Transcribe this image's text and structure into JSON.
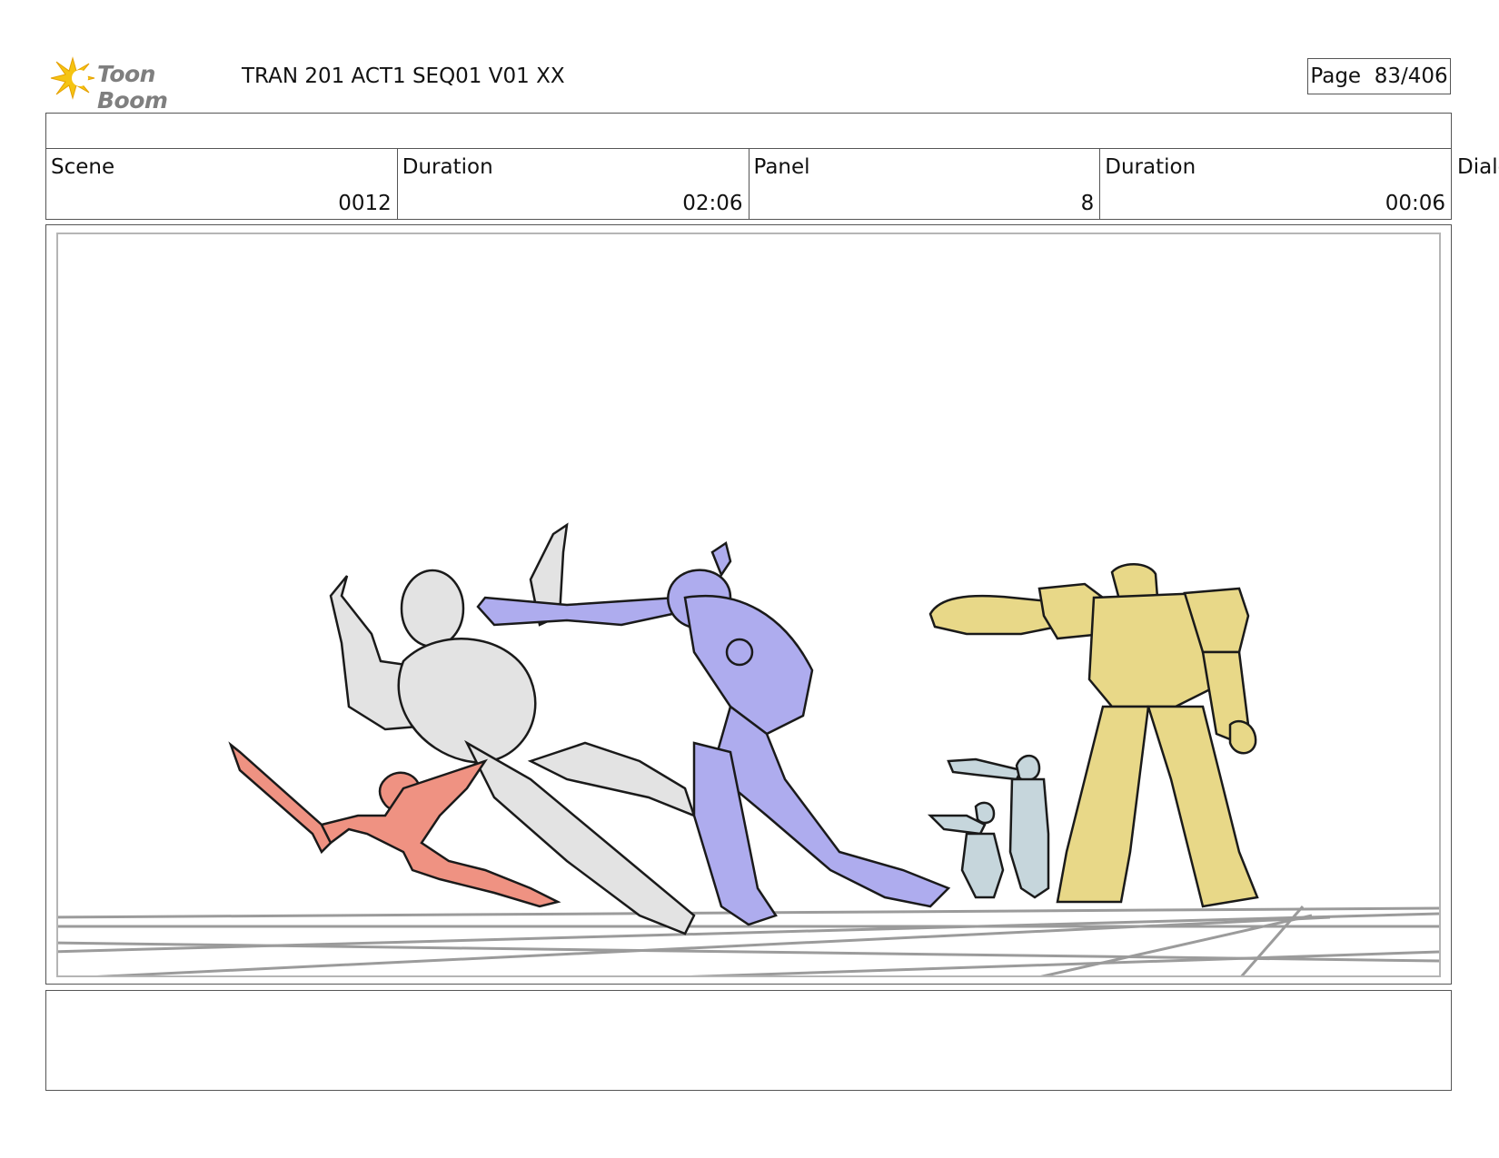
{
  "header": {
    "logo_text": "Toon Boom",
    "doc_title": "TRAN 201 ACT1 SEQ01 V01 XX",
    "page_label": "Page  83/406"
  },
  "info": {
    "scene_label": "Scene",
    "scene_value": "0012",
    "scene_duration_label": "Duration",
    "scene_duration_value": "02:06",
    "panel_label": "Panel",
    "panel_value": "8",
    "panel_duration_label": "Duration",
    "panel_duration_value": "00:06",
    "dialog_label": "Dialo"
  },
  "colors": {
    "figure_grey": "#e3e3e3",
    "figure_violet": "#aeacee",
    "figure_red": "#ef9282",
    "figure_blue": "#c6d6dc",
    "figure_yellow": "#e8d888",
    "logo_yellow": "#f5c412",
    "floor_grey": "#9b9b9b"
  }
}
